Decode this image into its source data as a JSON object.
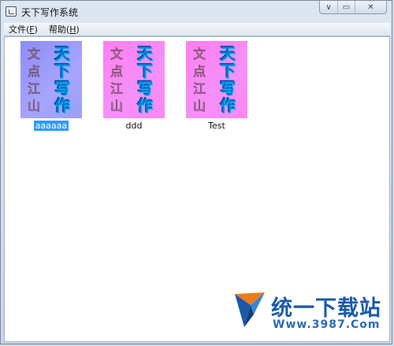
{
  "window": {
    "title": "天下写作系统",
    "controls": {
      "minimize": "∨",
      "maximize": "▭",
      "close": "✕"
    }
  },
  "menu": {
    "items": [
      {
        "label": "文件(",
        "key": "F",
        "suffix": ")"
      },
      {
        "label": "帮助(",
        "key": "H",
        "suffix": ")"
      }
    ]
  },
  "books": [
    {
      "name": "aaaaaa",
      "cover_color": "#a0a0f5",
      "left_text": [
        "文",
        "点",
        "江",
        "山"
      ],
      "right_text": [
        "天",
        "下",
        "写",
        "作"
      ],
      "selected": true
    },
    {
      "name": "ddd",
      "cover_color": "#ff82f0",
      "left_text": [
        "文",
        "点",
        "江",
        "山"
      ],
      "right_text": [
        "天",
        "下",
        "写",
        "作"
      ],
      "selected": false
    },
    {
      "name": "Test",
      "cover_color": "#ff82f0",
      "left_text": [
        "文",
        "点",
        "江",
        "山"
      ],
      "right_text": [
        "天",
        "下",
        "写",
        "作"
      ],
      "selected": false
    }
  ],
  "watermark": {
    "name": "统一下载站",
    "url": "Www.3987.Com",
    "colors": {
      "blue": "#1a5aa8",
      "orange": "#f07a1a"
    }
  }
}
